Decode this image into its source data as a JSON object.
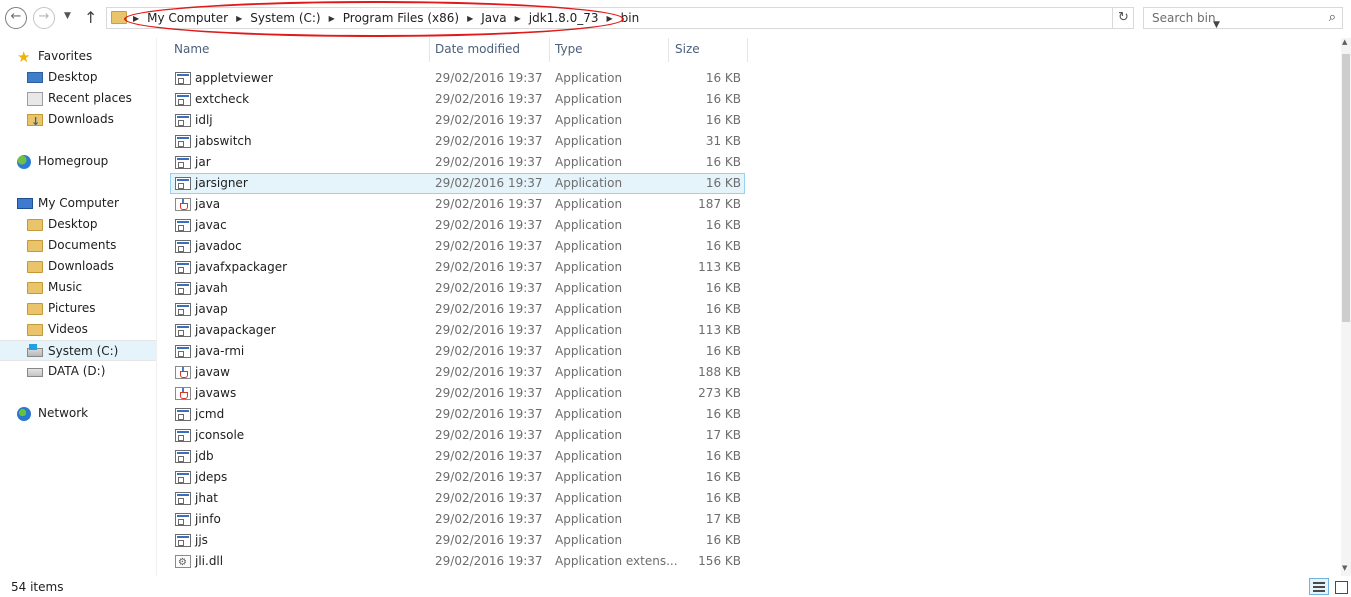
{
  "toolbar": {
    "back_icon": "arrow-left-icon",
    "forward_icon": "arrow-right-icon",
    "recent_icon": "chevron-down-icon",
    "up_icon": "arrow-up-icon",
    "breadcrumbs": [
      "My Computer",
      "System (C:)",
      "Program Files (x86)",
      "Java",
      "jdk1.8.0_73",
      "bin"
    ],
    "annotation_color": "#e01919",
    "refresh_icon": "refresh-icon",
    "search_placeholder": "Search bin"
  },
  "navigation": {
    "favorites": {
      "label": "Favorites",
      "items": [
        "Desktop",
        "Recent places",
        "Downloads"
      ]
    },
    "homegroup": {
      "label": "Homegroup"
    },
    "computer": {
      "label": "My  Computer",
      "items": [
        "Desktop",
        "Documents",
        "Downloads",
        "Music",
        "Pictures",
        "Videos",
        "System (C:)",
        "DATA (D:)"
      ],
      "selected": "System (C:)"
    },
    "network": {
      "label": "Network"
    }
  },
  "columns": {
    "name": "Name",
    "date": "Date modified",
    "type": "Type",
    "size": "Size"
  },
  "files": [
    {
      "name": "appletviewer",
      "date": "29/02/2016 19:37",
      "type": "Application",
      "size": "16 KB",
      "icon": "app"
    },
    {
      "name": "extcheck",
      "date": "29/02/2016 19:37",
      "type": "Application",
      "size": "16 KB",
      "icon": "app"
    },
    {
      "name": "idlj",
      "date": "29/02/2016 19:37",
      "type": "Application",
      "size": "16 KB",
      "icon": "app"
    },
    {
      "name": "jabswitch",
      "date": "29/02/2016 19:37",
      "type": "Application",
      "size": "31 KB",
      "icon": "app"
    },
    {
      "name": "jar",
      "date": "29/02/2016 19:37",
      "type": "Application",
      "size": "16 KB",
      "icon": "app"
    },
    {
      "name": "jarsigner",
      "date": "29/02/2016 19:37",
      "type": "Application",
      "size": "16 KB",
      "icon": "app",
      "selected": true
    },
    {
      "name": "java",
      "date": "29/02/2016 19:37",
      "type": "Application",
      "size": "187 KB",
      "icon": "java"
    },
    {
      "name": "javac",
      "date": "29/02/2016 19:37",
      "type": "Application",
      "size": "16 KB",
      "icon": "app"
    },
    {
      "name": "javadoc",
      "date": "29/02/2016 19:37",
      "type": "Application",
      "size": "16 KB",
      "icon": "app"
    },
    {
      "name": "javafxpackager",
      "date": "29/02/2016 19:37",
      "type": "Application",
      "size": "113 KB",
      "icon": "app"
    },
    {
      "name": "javah",
      "date": "29/02/2016 19:37",
      "type": "Application",
      "size": "16 KB",
      "icon": "app"
    },
    {
      "name": "javap",
      "date": "29/02/2016 19:37",
      "type": "Application",
      "size": "16 KB",
      "icon": "app"
    },
    {
      "name": "javapackager",
      "date": "29/02/2016 19:37",
      "type": "Application",
      "size": "113 KB",
      "icon": "app"
    },
    {
      "name": "java-rmi",
      "date": "29/02/2016 19:37",
      "type": "Application",
      "size": "16 KB",
      "icon": "app"
    },
    {
      "name": "javaw",
      "date": "29/02/2016 19:37",
      "type": "Application",
      "size": "188 KB",
      "icon": "java"
    },
    {
      "name": "javaws",
      "date": "29/02/2016 19:37",
      "type": "Application",
      "size": "273 KB",
      "icon": "java"
    },
    {
      "name": "jcmd",
      "date": "29/02/2016 19:37",
      "type": "Application",
      "size": "16 KB",
      "icon": "app"
    },
    {
      "name": "jconsole",
      "date": "29/02/2016 19:37",
      "type": "Application",
      "size": "17 KB",
      "icon": "app"
    },
    {
      "name": "jdb",
      "date": "29/02/2016 19:37",
      "type": "Application",
      "size": "16 KB",
      "icon": "app"
    },
    {
      "name": "jdeps",
      "date": "29/02/2016 19:37",
      "type": "Application",
      "size": "16 KB",
      "icon": "app"
    },
    {
      "name": "jhat",
      "date": "29/02/2016 19:37",
      "type": "Application",
      "size": "16 KB",
      "icon": "app"
    },
    {
      "name": "jinfo",
      "date": "29/02/2016 19:37",
      "type": "Application",
      "size": "17 KB",
      "icon": "app"
    },
    {
      "name": "jjs",
      "date": "29/02/2016 19:37",
      "type": "Application",
      "size": "16 KB",
      "icon": "app"
    },
    {
      "name": "jli.dll",
      "date": "29/02/2016 19:37",
      "type": "Application extens...",
      "size": "156 KB",
      "icon": "dll"
    }
  ],
  "status": {
    "item_count": "54 items"
  }
}
